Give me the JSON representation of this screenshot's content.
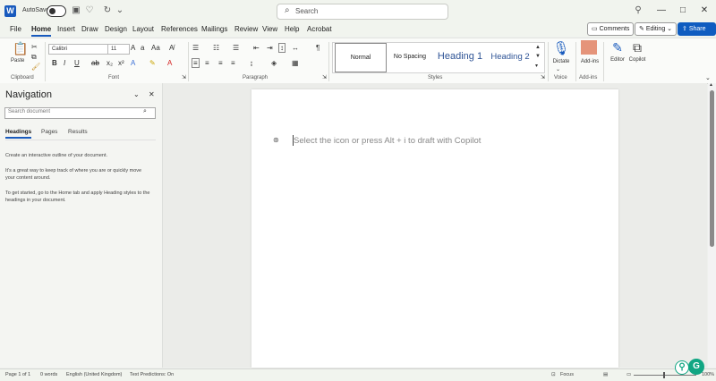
{
  "titlebar": {
    "autosave_label": "AutoSave",
    "autosave_state": "off",
    "search_placeholder": "Search",
    "controls": [
      "—",
      "□",
      "✕"
    ]
  },
  "menu": {
    "tabs": [
      "File",
      "Home",
      "Insert",
      "Draw",
      "Design",
      "Layout",
      "References",
      "Mailings",
      "Review",
      "View",
      "Help",
      "Acrobat"
    ],
    "active_tab": "Home",
    "comments_label": "Comments",
    "editing_label": "Editing",
    "share_label": "Share"
  },
  "ribbon": {
    "clipboard": {
      "paste_label": "Paste",
      "group_label": "Clipboard"
    },
    "font": {
      "font_name": "Calibri",
      "font_size": "11",
      "group_label": "Font"
    },
    "paragraph": {
      "group_label": "Paragraph"
    },
    "styles": {
      "items": [
        "Normal",
        "No Spacing",
        "Heading 1",
        "Heading 2"
      ],
      "group_label": "Styles"
    },
    "voice": {
      "dictate_label": "Dictate",
      "group_label": "Voice"
    },
    "addins": {
      "label": "Add-ins",
      "group_label": "Add-ins"
    },
    "editor_label": "Editor",
    "copilot_label": "Copilot"
  },
  "navigation": {
    "title": "Navigation",
    "search_placeholder": "Search document",
    "tabs": [
      "Headings",
      "Pages",
      "Results"
    ],
    "active_tab": "Headings",
    "text1": "Create an interactive outline of your document.",
    "text2": "It's a great way to keep track of where you are or quickly move your content around.",
    "text3": "To get started, go to the Home tab and apply Heading styles to the headings in your document."
  },
  "document": {
    "copilot_hint": "Select the icon or press Alt + i to draft with Copilot"
  },
  "status": {
    "page": "Page 1 of 1",
    "words": "0 words",
    "language": "English (United Kingdom)",
    "predictions": "Text Predictions: On",
    "focus": "Focus",
    "zoom": "100%"
  },
  "colors": {
    "accent": "#185abd",
    "share": "#0f5cc0",
    "grammarly": "#11a683"
  }
}
